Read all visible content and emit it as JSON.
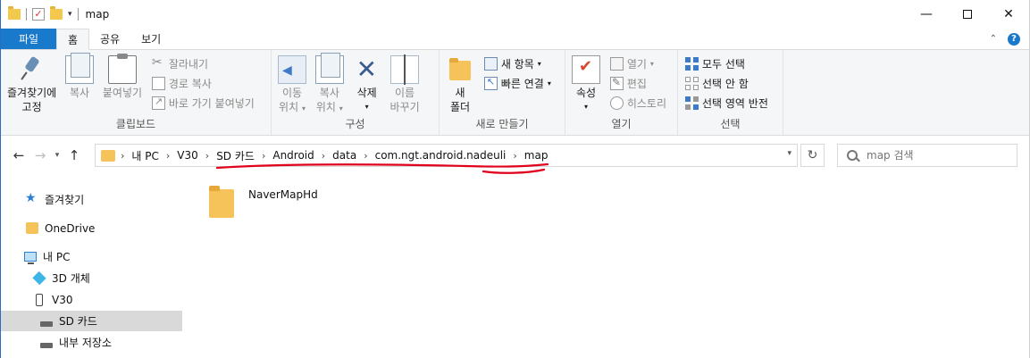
{
  "window": {
    "title": "map",
    "controls": {
      "minimize": "—",
      "maximize": "",
      "close": "✕"
    }
  },
  "ribbon_tabs": [
    {
      "label": "파일",
      "active": false
    },
    {
      "label": "홈",
      "active": true
    },
    {
      "label": "공유",
      "active": false
    },
    {
      "label": "보기",
      "active": false
    }
  ],
  "ribbon": {
    "clipboard": {
      "label": "클립보드",
      "pin": "즐겨찾기에",
      "pin2": "고정",
      "copy": "복사",
      "paste": "붙여넣기",
      "cut": "잘라내기",
      "copy_path": "경로 복사",
      "paste_shortcut": "바로 가기 붙여넣기"
    },
    "organize": {
      "label": "구성",
      "move_to": "이동",
      "move_to2": "위치",
      "copy_to": "복사",
      "copy_to2": "위치",
      "delete": "삭제",
      "rename": "이름",
      "rename2": "바꾸기"
    },
    "new": {
      "label": "새로 만들기",
      "new_folder": "새",
      "new_folder2": "폴더",
      "new_item": "새 항목",
      "easy_access": "빠른 연결"
    },
    "open": {
      "label": "열기",
      "properties": "속성",
      "open": "열기",
      "edit": "편집",
      "history": "히스토리"
    },
    "select": {
      "label": "선택",
      "select_all": "모두 선택",
      "select_none": "선택 안 함",
      "invert": "선택 영역 반전"
    }
  },
  "address": {
    "crumbs": [
      "내 PC",
      "V30",
      "SD 카드",
      "Android",
      "data",
      "com.ngt.android.nadeuli",
      "map"
    ]
  },
  "search": {
    "placeholder": "map 검색"
  },
  "nav_pane": [
    {
      "label": "즐겨찾기",
      "icon": "star-icon"
    },
    {
      "label": "OneDrive",
      "icon": "folder-icon"
    },
    {
      "label": "내 PC",
      "icon": "pc-icon"
    },
    {
      "label": "3D 개체",
      "icon": "3d-objects-icon"
    },
    {
      "label": "V30",
      "icon": "phone-icon"
    },
    {
      "label": "SD 카드",
      "icon": "drive-icon",
      "selected": true
    },
    {
      "label": "내부 저장소",
      "icon": "drive-icon"
    }
  ],
  "files": [
    {
      "name": "NaverMapHd",
      "type": "folder"
    }
  ],
  "colors": {
    "file_tab": "#1979ca",
    "annotation": "#e0001b",
    "folder": "#f6c25a",
    "selection": "#d9d9d9"
  }
}
